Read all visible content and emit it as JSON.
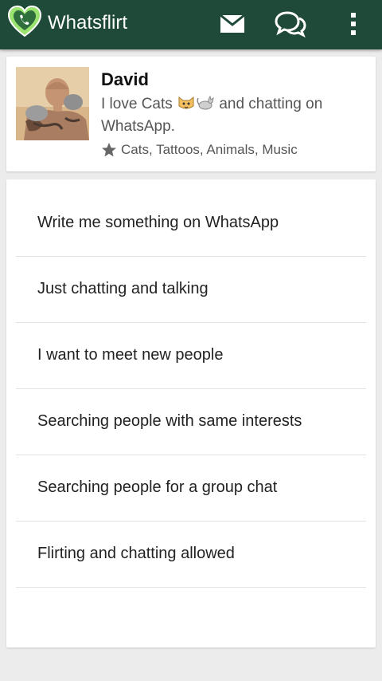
{
  "app": {
    "title": "Whatsflirt",
    "brand_color": "#1f4a39",
    "accent_color": "#4caf50"
  },
  "toolbar": {
    "icons": [
      "mail-icon",
      "chat-bubbles-icon",
      "overflow-menu-icon"
    ]
  },
  "profile": {
    "name": "David",
    "bio_before": "I love Cats",
    "bio_emoji": [
      "cat-face-emoji",
      "cat-emoji"
    ],
    "bio_after": " and chatting on WhatsApp.",
    "interests": "Cats, Tattoos, Animals, Music"
  },
  "options": [
    "Write me something on WhatsApp",
    "Just chatting and talking",
    "I want to meet new people",
    "Searching people with same interests",
    "Searching people for a group chat",
    "Flirting and chatting allowed"
  ]
}
